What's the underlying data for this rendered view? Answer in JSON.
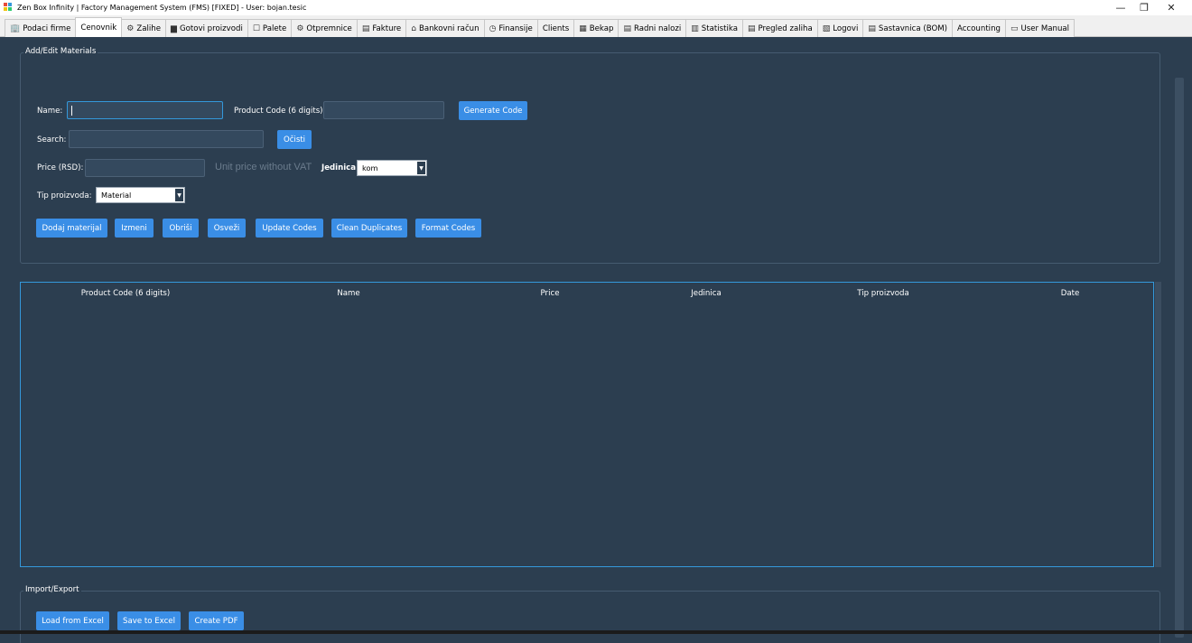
{
  "window": {
    "title": "Zen Box Infinity | Factory Management System (FMS) [FIXED] - User: bojan.tesic",
    "controls": {
      "minimize": "—",
      "maximize": "❐",
      "close": "✕"
    }
  },
  "tabs": [
    {
      "label": "Podaci firme",
      "icon": "🏢"
    },
    {
      "label": "Cenovnik",
      "icon": ""
    },
    {
      "label": "Zalihe",
      "icon": "⚙"
    },
    {
      "label": "Gotovi proizvodi",
      "icon": "▆"
    },
    {
      "label": "Palete",
      "icon": "☐"
    },
    {
      "label": "Otpremnice",
      "icon": "⚙"
    },
    {
      "label": "Fakture",
      "icon": "▤"
    },
    {
      "label": "Bankovni račun",
      "icon": "⌂"
    },
    {
      "label": "Finansije",
      "icon": "◷"
    },
    {
      "label": "Clients",
      "icon": ""
    },
    {
      "label": "Bekap",
      "icon": "▦"
    },
    {
      "label": "Radni nalozi",
      "icon": "▤"
    },
    {
      "label": "Statistika",
      "icon": "▥"
    },
    {
      "label": "Pregled zaliha",
      "icon": "▤"
    },
    {
      "label": "Logovi",
      "icon": "▧"
    },
    {
      "label": "Sastavnica (BOM)",
      "icon": "▤"
    },
    {
      "label": "Accounting",
      "icon": ""
    },
    {
      "label": "User Manual",
      "icon": "▭"
    }
  ],
  "active_tab": "Cenovnik",
  "form": {
    "group_title": "Add/Edit Materials",
    "name_label": "Name:",
    "name_value": "",
    "product_code_label": "Product Code (6 digits)",
    "product_code_value": "",
    "generate_code_button": "Generate Code",
    "search_label": "Search:",
    "search_value": "",
    "clear_button": "Očisti",
    "price_label": "Price (RSD):",
    "price_value": "",
    "price_hint": "Unit price without VAT",
    "unit_label": "Jedinica",
    "unit_value": "kom",
    "type_label": "Tip proizvoda:",
    "type_value": "Material",
    "buttons": {
      "add": "Dodaj materijal",
      "edit": "Izmeni",
      "delete": "Obriši",
      "refresh": "Osveži",
      "update_codes": "Update Codes",
      "clean_duplicates": "Clean Duplicates",
      "format_codes": "Format Codes"
    }
  },
  "table": {
    "columns": [
      "Product Code (6 digits)",
      "Name",
      "Price",
      "Jedinica",
      "Tip proizvoda",
      "Date"
    ],
    "rows": []
  },
  "import_export": {
    "group_title": "Import/Export",
    "load_excel": "Load from Excel",
    "save_excel": "Save to Excel",
    "create_pdf": "Create PDF"
  },
  "colors": {
    "background": "#2c3e50",
    "accent": "#3a8ee6",
    "input_bg": "#34495e"
  }
}
